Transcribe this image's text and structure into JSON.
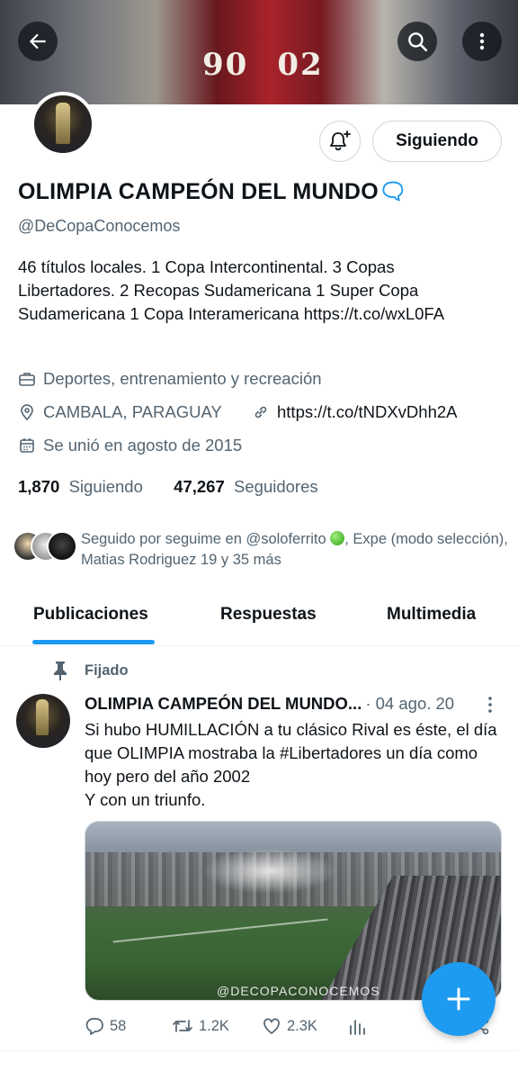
{
  "header": {
    "banner_text_left": "90",
    "banner_text_right": "02"
  },
  "profile": {
    "notify_button": "bell-plus-icon",
    "follow_button": "Siguiendo",
    "display_name": "OLIMPIA CAMPEÓN DEL MUNDO",
    "display_name_emoji": "🗨",
    "handle": "@DeCopaConocemos",
    "bio": "46 títulos locales. 1 Copa Intercontinental. 3 Copas Libertadores. 2 Recopas Sudamericana 1 Super Copa Sudamericana  1 Copa Interamericana https://t.co/wxL0FA",
    "category": "Deportes, entrenamiento y recreación",
    "location": "CAMBALA, PARAGUAY",
    "website": "https://t.co/tNDXvDhh2A",
    "joined": "Se unió en agosto de 2015",
    "following_count": "1,870",
    "following_label": "Siguiendo",
    "followers_count": "47,267",
    "followers_label": "Seguidores",
    "followed_by_prefix": "Seguido por seguime en @soloferrito",
    "followed_by_suffix": ", Expe (modo selección), Matias Rodriguez 19 y 35 más"
  },
  "tabs": [
    {
      "label": "Publicaciones",
      "active": true
    },
    {
      "label": "Respuestas",
      "active": false
    },
    {
      "label": "Multimedia",
      "active": false
    }
  ],
  "pinned_tweet": {
    "pinned_label": "Fijado",
    "author_name": "OLIMPIA CAMPEÓN DEL MUNDO...",
    "time": "· 04 ago. 20",
    "text": "Si hubo HUMILLACIÓN a tu clásico Rival es éste, el día que OLIMPIA mostraba la #Libertadores  un día como hoy pero del año 2002\nY con un triunfo.",
    "media_watermark": "@DECOPACONOCEMOS",
    "replies": "58",
    "retweets": "1.2K",
    "likes": "2.3K"
  },
  "colors": {
    "accent": "#1d9bf0",
    "text_primary": "#0f1419",
    "text_secondary": "#536471",
    "border": "#cfd9de"
  }
}
